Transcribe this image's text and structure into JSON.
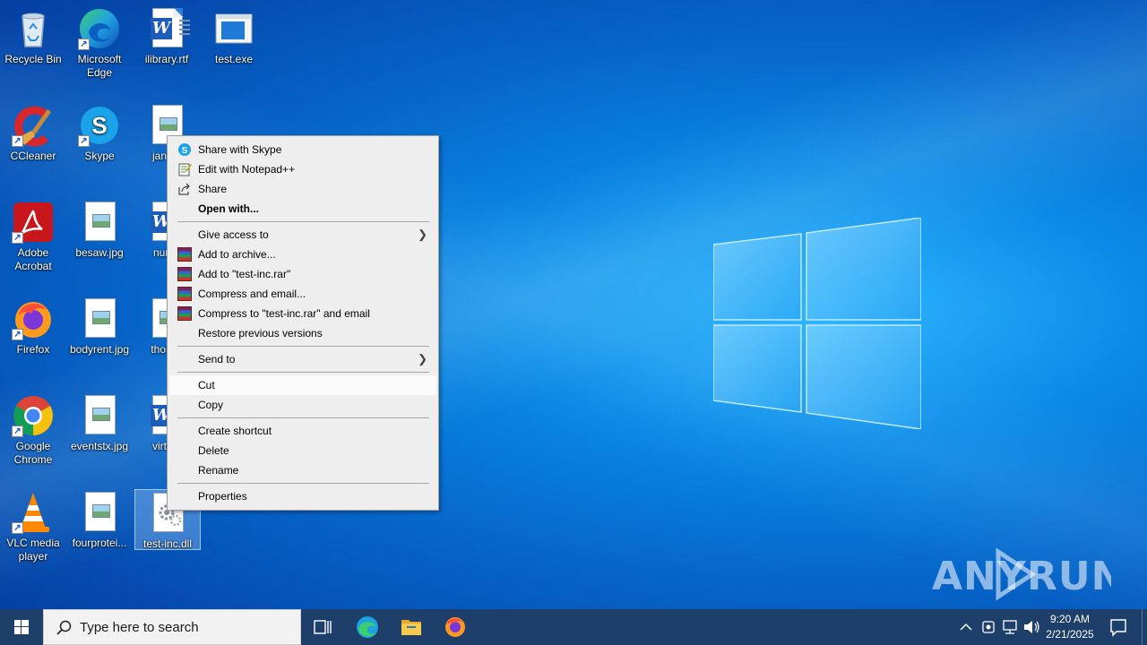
{
  "desktop": {
    "icons": [
      {
        "label": "Recycle Bin",
        "icon": "recycle-bin-icon"
      },
      {
        "label": "Microsoft Edge",
        "icon": "edge-icon"
      },
      {
        "label": "ilibrary.rtf",
        "icon": "word-document-icon"
      },
      {
        "label": "test.exe",
        "icon": "exe-file-icon"
      },
      {
        "label": "CCleaner",
        "icon": "ccleaner-icon"
      },
      {
        "label": "Skype",
        "icon": "skype-icon"
      },
      {
        "label": "janbal",
        "icon": "image-file-icon"
      },
      {
        "label": "Adobe Acrobat",
        "icon": "acrobat-icon"
      },
      {
        "label": "besaw.jpg",
        "icon": "image-file-icon"
      },
      {
        "label": "numb",
        "icon": "word-document-icon"
      },
      {
        "label": "Firefox",
        "icon": "firefox-icon"
      },
      {
        "label": "bodyrent.jpg",
        "icon": "image-file-icon"
      },
      {
        "label": "thoses",
        "icon": "image-file-icon"
      },
      {
        "label": "Google Chrome",
        "icon": "chrome-icon"
      },
      {
        "label": "eventstx.jpg",
        "icon": "image-file-icon"
      },
      {
        "label": "virtual",
        "icon": "word-document-icon"
      },
      {
        "label": "VLC media player",
        "icon": "vlc-icon"
      },
      {
        "label": "fourprotei...",
        "icon": "image-file-icon"
      },
      {
        "label": "test-inc.dll",
        "icon": "dll-file-icon"
      }
    ]
  },
  "context_menu": {
    "items": [
      {
        "label": "Share with Skype",
        "icon": "skype-icon"
      },
      {
        "label": "Edit with Notepad++",
        "icon": "notepadpp-icon"
      },
      {
        "label": "Share",
        "icon": "share-icon"
      },
      {
        "label": "Open with...",
        "icon": ""
      },
      {
        "label": "Give access to",
        "icon": ""
      },
      {
        "label": "Add to archive...",
        "icon": "winrar-icon"
      },
      {
        "label": "Add to \"test-inc.rar\"",
        "icon": "winrar-icon"
      },
      {
        "label": "Compress and email...",
        "icon": "winrar-icon"
      },
      {
        "label": "Compress to \"test-inc.rar\" and email",
        "icon": "winrar-icon"
      },
      {
        "label": "Restore previous versions",
        "icon": ""
      },
      {
        "label": "Send to",
        "icon": ""
      },
      {
        "label": "Cut",
        "icon": ""
      },
      {
        "label": "Copy",
        "icon": ""
      },
      {
        "label": "Create shortcut",
        "icon": ""
      },
      {
        "label": "Delete",
        "icon": ""
      },
      {
        "label": "Rename",
        "icon": ""
      },
      {
        "label": "Properties",
        "icon": ""
      }
    ]
  },
  "taskbar": {
    "search_placeholder": "Type here to search",
    "pinned": [
      "task-view-icon",
      "edge-icon",
      "file-explorer-icon",
      "firefox-icon"
    ],
    "clock": {
      "time": "9:20 AM",
      "date": "2/21/2025"
    }
  },
  "watermark": "ANY RUN",
  "colors": {
    "taskbar": "#1e3f69",
    "menu_bg": "#eeeeee",
    "desktop_accent": "#0a8ae6"
  }
}
